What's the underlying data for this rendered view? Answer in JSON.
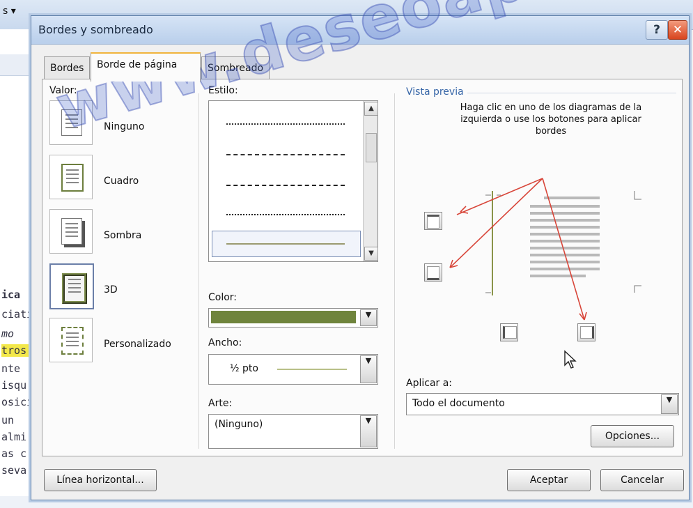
{
  "dialog": {
    "title": "Bordes y sombreado",
    "help_label": "?",
    "close_label": "✕",
    "tabs": [
      {
        "label": "Bordes",
        "active": false
      },
      {
        "label": "Borde de página",
        "active": true
      },
      {
        "label": "Sombreado",
        "active": false
      }
    ]
  },
  "setting": {
    "label": "Valor:",
    "options": [
      "Ninguno",
      "Cuadro",
      "Sombra",
      "3D",
      "Personalizado"
    ],
    "selected": "3D"
  },
  "style": {
    "label": "Estilo:",
    "scroll_up": "▲",
    "scroll_down": "▼"
  },
  "color": {
    "label": "Color:",
    "value_hex": "#6f843c"
  },
  "width": {
    "label": "Ancho:",
    "value": "½ pto"
  },
  "art": {
    "label": "Arte:",
    "value": "(Ninguno)"
  },
  "preview": {
    "label": "Vista previa",
    "hint": "Haga clic en uno de los diagramas de la izquierda o use los botones para aplicar bordes"
  },
  "apply": {
    "label": "Aplicar a:",
    "value": "Todo el documento"
  },
  "buttons": {
    "options": "Opciones...",
    "horizontal_line": "Línea horizontal...",
    "ok": "Aceptar",
    "cancel": "Cancelar"
  },
  "watermark": "www.deseoaprender.com",
  "background_doc": {
    "ribbon_fragment": "s ▾",
    "lines": [
      "ica",
      "ciati",
      "mo",
      "tros",
      "nte",
      "isqu",
      "osici",
      "un",
      "almi",
      "as c",
      "seva"
    ]
  },
  "colors": {
    "accent_tab": "#f0b43c",
    "arrow": "#d8463a",
    "border_olive": "#6f843c"
  }
}
